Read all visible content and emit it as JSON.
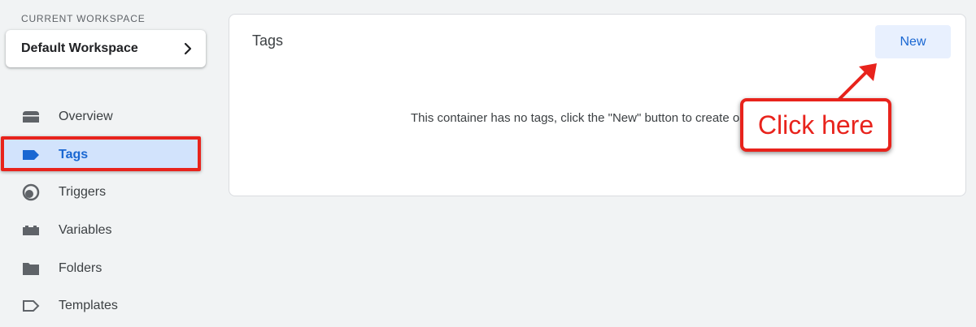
{
  "workspace": {
    "section_label": "CURRENT WORKSPACE",
    "name": "Default Workspace",
    "chevron_icon": "chevron-right-icon"
  },
  "nav": {
    "items": [
      {
        "label": "Overview",
        "icon": "overview-icon",
        "active": false
      },
      {
        "label": "Tags",
        "icon": "tag-icon",
        "active": true
      },
      {
        "label": "Triggers",
        "icon": "trigger-icon",
        "active": false
      },
      {
        "label": "Variables",
        "icon": "variables-icon",
        "active": false
      },
      {
        "label": "Folders",
        "icon": "folder-icon",
        "active": false
      },
      {
        "label": "Templates",
        "icon": "template-icon",
        "active": false
      }
    ]
  },
  "main": {
    "title": "Tags",
    "new_button_label": "New",
    "empty_message": "This container has no tags, click the \"New\" button to create one."
  },
  "annotation": {
    "callout_text": "Click here",
    "color": "#e8231c"
  },
  "colors": {
    "accent": "#1967d2",
    "active_bg": "#d2e3fc",
    "page_bg": "#f1f3f4"
  }
}
